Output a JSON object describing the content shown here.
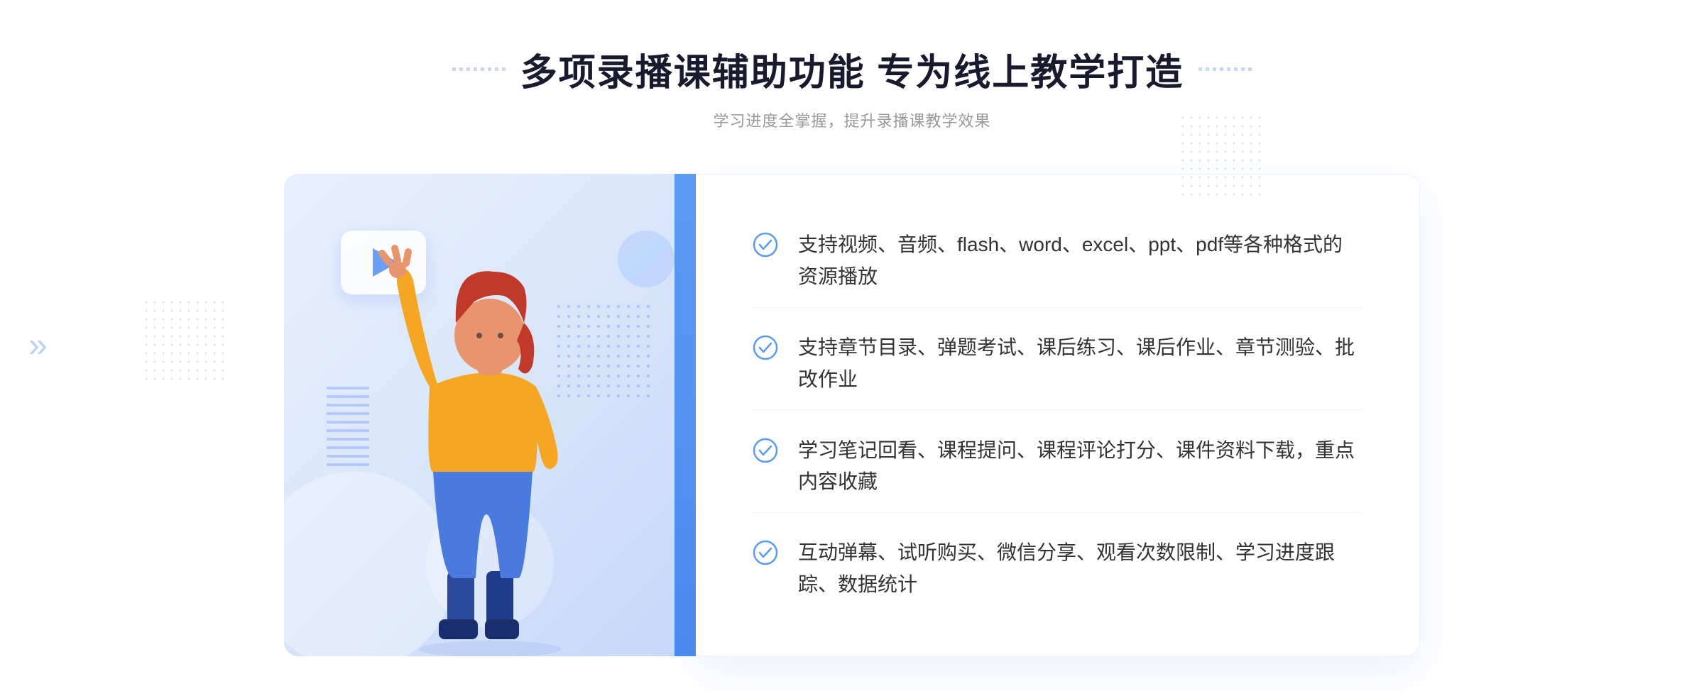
{
  "header": {
    "title": "多项录播课辅助功能 专为线上教学打造",
    "subtitle": "学习进度全掌握，提升录播课教学效果"
  },
  "features": [
    {
      "id": 1,
      "text": "支持视频、音频、flash、word、excel、ppt、pdf等各种格式的资源播放"
    },
    {
      "id": 2,
      "text": "支持章节目录、弹题考试、课后练习、课后作业、章节测验、批改作业"
    },
    {
      "id": 3,
      "text": "学习笔记回看、课程提问、课程评论打分、课件资料下载，重点内容收藏"
    },
    {
      "id": 4,
      "text": "互动弹幕、试听购买、微信分享、观看次数限制、学习进度跟踪、数据统计"
    }
  ],
  "decorative": {
    "chevron_char": "»",
    "play_aria": "play-button"
  }
}
